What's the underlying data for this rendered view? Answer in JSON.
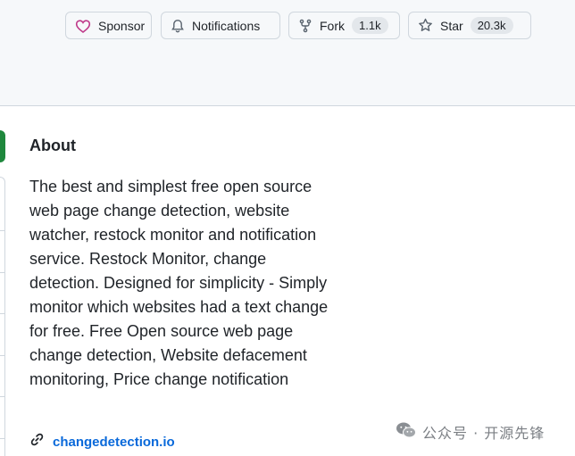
{
  "actions": {
    "sponsor": {
      "label": "Sponsor",
      "icon": "heart-icon",
      "icon_color": "#bf3989"
    },
    "notifications": {
      "label": "Notifications",
      "icon": "bell-icon"
    },
    "fork": {
      "label": "Fork",
      "count": "1.1k",
      "icon": "repo-forked-icon"
    },
    "star": {
      "label": "Star",
      "count": "20.3k",
      "icon": "star-icon"
    }
  },
  "about": {
    "title": "About",
    "description": "The best and simplest free open source web page change detection, website watcher, restock monitor and notification service. Restock Monitor, change detection. Designed for simplicity - Simply monitor which websites had a text change for free. Free Open source web page change detection, Website defacement monitoring, Price change notification",
    "website": {
      "label": "changedetection.io",
      "icon": "link-icon"
    }
  },
  "watermark": {
    "text": "公众号 · 开源先锋",
    "icon": "wechat-icon"
  },
  "colors": {
    "link": "#0969da",
    "accent_green": "#1f883d",
    "header_bg": "#f6f8fa",
    "border": "#d0d7de"
  }
}
